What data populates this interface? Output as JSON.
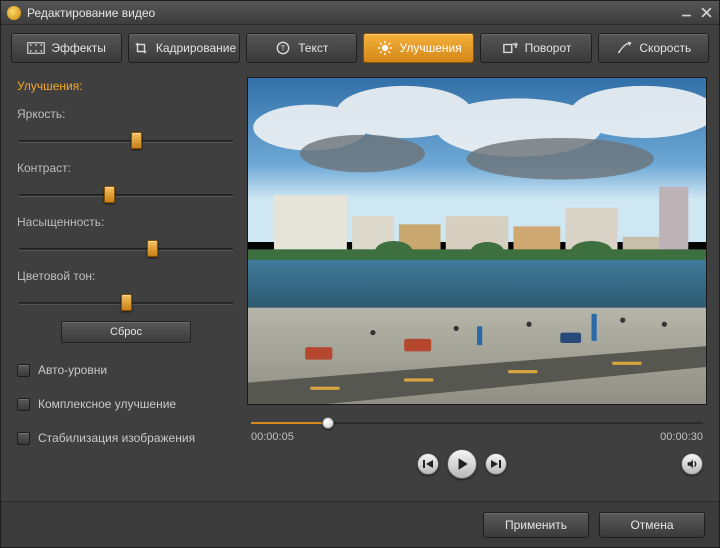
{
  "window": {
    "title": "Редактирование видео"
  },
  "tabs": {
    "effects": "Эффекты",
    "crop": "Кадрирование",
    "text": "Текст",
    "enhance": "Улучшения",
    "rotate": "Поворот",
    "speed": "Скорость",
    "active": "enhance"
  },
  "panel": {
    "header": "Улучшения:",
    "brightness_label": "Яркость:",
    "contrast_label": "Контраст:",
    "saturation_label": "Насыщенность:",
    "hue_label": "Цветовой тон:",
    "reset_label": "Сброс",
    "auto_levels_label": "Авто-уровни",
    "complex_enhance_label": "Комплексное улучшение",
    "stabilize_label": "Стабилизация изображения",
    "sliders": {
      "brightness": 0.55,
      "contrast": 0.42,
      "saturation": 0.63,
      "hue": 0.5
    },
    "checks": {
      "auto_levels": false,
      "complex_enhance": false,
      "stabilize": false
    }
  },
  "playback": {
    "current_time": "00:00:05",
    "total_time": "00:00:30",
    "progress": 0.17
  },
  "footer": {
    "apply": "Применить",
    "cancel": "Отмена"
  },
  "colors": {
    "accent": "#e69a1c",
    "tab_active_top": "#f5b13c",
    "tab_active_bottom": "#d38717",
    "bg": "#3f3f3f"
  }
}
